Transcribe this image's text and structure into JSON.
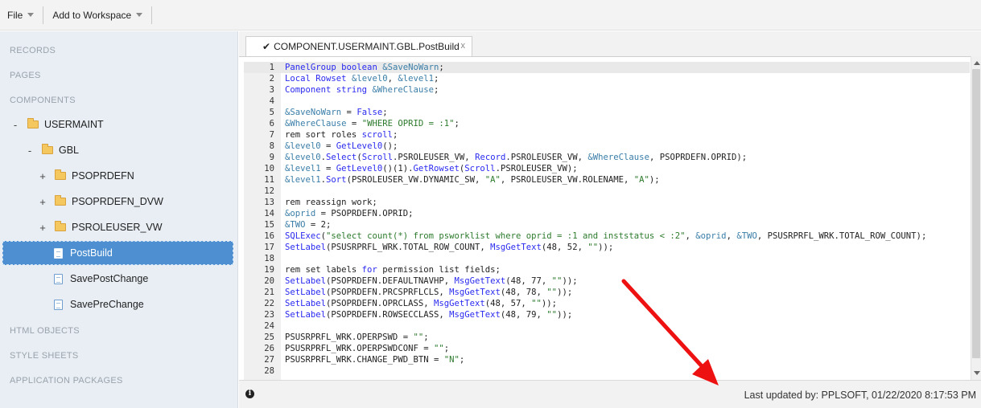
{
  "menubar": {
    "file_label": "File",
    "add_to_workspace_label": "Add to Workspace"
  },
  "sidebar": {
    "sections": {
      "records": "RECORDS",
      "pages": "PAGES",
      "components": "COMPONENTS",
      "html_objects": "HTML OBJECTS",
      "style_sheets": "STYLE SHEETS",
      "application_packages": "APPLICATION PACKAGES"
    },
    "tree": {
      "usermaint": "USERMAINT",
      "gbl": "GBL",
      "psoprdefn": "PSOPRDEFN",
      "psoprdefn_dvw": "PSOPRDEFN_DVW",
      "psroleuser_vw": "PSROLEUSER_VW",
      "postbuild": "PostBuild",
      "savepostchange": "SavePostChange",
      "saveprechange": "SavePreChange",
      "collapse_symbol": "-",
      "expand_symbol": "+"
    }
  },
  "editor": {
    "tab_title": "COMPONENT.USERMAINT.GBL.PostBuild",
    "tab_check": "✔",
    "tab_close": "x",
    "lines": [
      {
        "n": "1",
        "t": "PanelGroup boolean &SaveNoWarn;"
      },
      {
        "n": "2",
        "t": "Local Rowset &level0, &level1;"
      },
      {
        "n": "3",
        "t": "Component string &WhereClause;"
      },
      {
        "n": "4",
        "t": ""
      },
      {
        "n": "5",
        "t": "&SaveNoWarn = False;"
      },
      {
        "n": "6",
        "t": "&WhereClause = \"WHERE OPRID = :1\";"
      },
      {
        "n": "7",
        "t": "rem sort roles scroll;"
      },
      {
        "n": "8",
        "t": "&level0 = GetLevel0();"
      },
      {
        "n": "9",
        "t": "&level0.Select(Scroll.PSROLEUSER_VW, Record.PSROLEUSER_VW, &WhereClause, PSOPRDEFN.OPRID);"
      },
      {
        "n": "10",
        "t": "&level1 = GetLevel0()(1).GetRowset(Scroll.PSROLEUSER_VW);"
      },
      {
        "n": "11",
        "t": "&level1.Sort(PSROLEUSER_VW.DYNAMIC_SW, \"A\", PSROLEUSER_VW.ROLENAME, \"A\");"
      },
      {
        "n": "12",
        "t": ""
      },
      {
        "n": "13",
        "t": "rem reassign work;"
      },
      {
        "n": "14",
        "t": "&oprid = PSOPRDEFN.OPRID;"
      },
      {
        "n": "15",
        "t": "&TWO = 2;"
      },
      {
        "n": "16",
        "t": "SQLExec(\"select count(*) from psworklist where oprid = :1 and inststatus < :2\", &oprid, &TWO, PSUSRPRFL_WRK.TOTAL_ROW_COUNT);"
      },
      {
        "n": "17",
        "t": "SetLabel(PSUSRPRFL_WRK.TOTAL_ROW_COUNT, MsgGetText(48, 52, \"\"));"
      },
      {
        "n": "18",
        "t": ""
      },
      {
        "n": "19",
        "t": "rem set labels for permission list fields;"
      },
      {
        "n": "20",
        "t": "SetLabel(PSOPRDEFN.DEFAULTNAVHP, MsgGetText(48, 77, \"\"));"
      },
      {
        "n": "21",
        "t": "SetLabel(PSOPRDEFN.PRCSPRFLCLS, MsgGetText(48, 78, \"\"));"
      },
      {
        "n": "22",
        "t": "SetLabel(PSOPRDEFN.OPRCLASS, MsgGetText(48, 57, \"\"));"
      },
      {
        "n": "23",
        "t": "SetLabel(PSOPRDEFN.ROWSECCLASS, MsgGetText(48, 79, \"\"));"
      },
      {
        "n": "24",
        "t": ""
      },
      {
        "n": "25",
        "t": "PSUSRPRFL_WRK.OPERPSWD = \"\";"
      },
      {
        "n": "26",
        "t": "PSUSRPRFL_WRK.OPERPSWDCONF = \"\";"
      },
      {
        "n": "27",
        "t": "PSUSRPRFL_WRK.CHANGE_PWD_BTN = \"N\";"
      },
      {
        "n": "28",
        "t": ""
      }
    ]
  },
  "status": {
    "info_icon_glyph": "i",
    "last_updated": "Last updated by: PPLSOFT, 01/22/2020 8:17:53 PM"
  },
  "colors": {
    "keyword": "#2a2af0",
    "variable": "#3a7ea8",
    "string": "#2c7a2c",
    "selected_bg": "#4d8fd0",
    "arrow": "#ee1111"
  }
}
